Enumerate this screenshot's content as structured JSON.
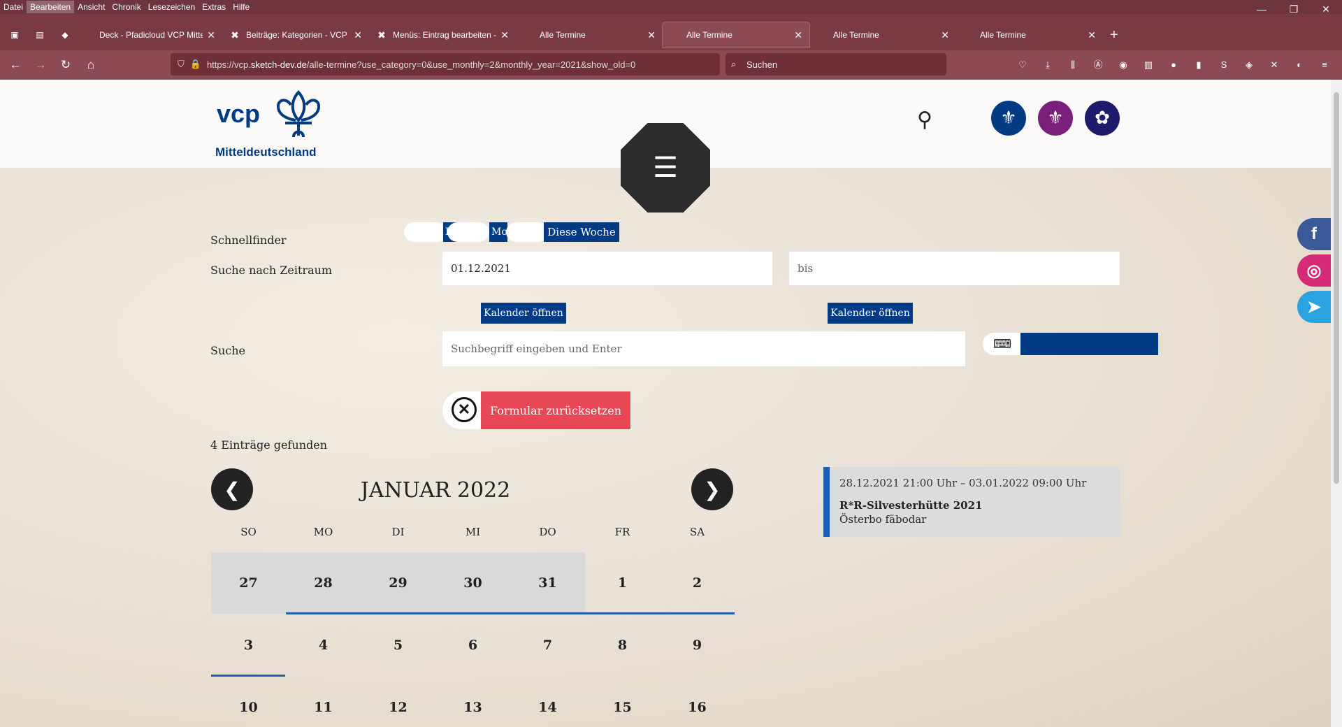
{
  "menubar": {
    "items": [
      "Datei",
      "Bearbeiten",
      "Ansicht",
      "Chronik",
      "Lesezeichen",
      "Extras",
      "Hilfe"
    ]
  },
  "tabs": [
    {
      "label": "Deck - Pfadicloud VCP Mitteldeu"
    },
    {
      "label": "Beiträge: Kategorien - VCP Mitte"
    },
    {
      "label": "Menüs: Eintrag bearbeiten - VCP"
    },
    {
      "label": "Alle Termine"
    },
    {
      "label": "Alle Termine"
    },
    {
      "label": "Alle Termine"
    },
    {
      "label": "Alle Termine"
    }
  ],
  "nav": {
    "url_prefix": "https://vcp.",
    "url_domain": "sketch-dev.de",
    "url_path": "/alle-termine?use_category=0&use_monthly=2&monthly_year=2021&show_old=0",
    "search_placeholder": "Suchen"
  },
  "site": {
    "logo_text": "vcp",
    "logo_subtitle": "Mitteldeutschland"
  },
  "form": {
    "schnellfinder_label": "Schnellfinder",
    "quick_heute": "H",
    "quick_monat": "Mo",
    "quick_woche": "Diese Woche",
    "zeitraum_label": "Suche nach Zeitraum",
    "date_from": "01.12.2021",
    "date_to_placeholder": "bis",
    "calendar_open_1": "Kalender öffnen",
    "calendar_open_2": "Kalender öffnen",
    "suche_label": "Suche",
    "search_placeholder": "Suchbegriff eingeben und Enter",
    "reset_label": "Formular zurücksetzen",
    "results_count": "4 Einträge gefunden"
  },
  "calendar": {
    "title": "JANUAR 2022",
    "prev": "❮",
    "next": "❯",
    "weekdays": [
      "SO",
      "MO",
      "DI",
      "MI",
      "DO",
      "FR",
      "SA"
    ],
    "weeks": [
      [
        "27",
        "28",
        "29",
        "30",
        "31",
        "1",
        "2"
      ],
      [
        "3",
        "4",
        "5",
        "6",
        "7",
        "8",
        "9"
      ],
      [
        "10",
        "11",
        "12",
        "13",
        "14",
        "15",
        "16"
      ]
    ]
  },
  "event": {
    "date": "28.12.2021 21:00 Uhr – 03.01.2022 09:00 Uhr",
    "title": "R*R-Silvesterhütte 2021",
    "location": "Österbo fäbodar"
  },
  "colors": {
    "brand": "#003b84",
    "reset": "#e84755",
    "accent": "#1e5fb4"
  }
}
